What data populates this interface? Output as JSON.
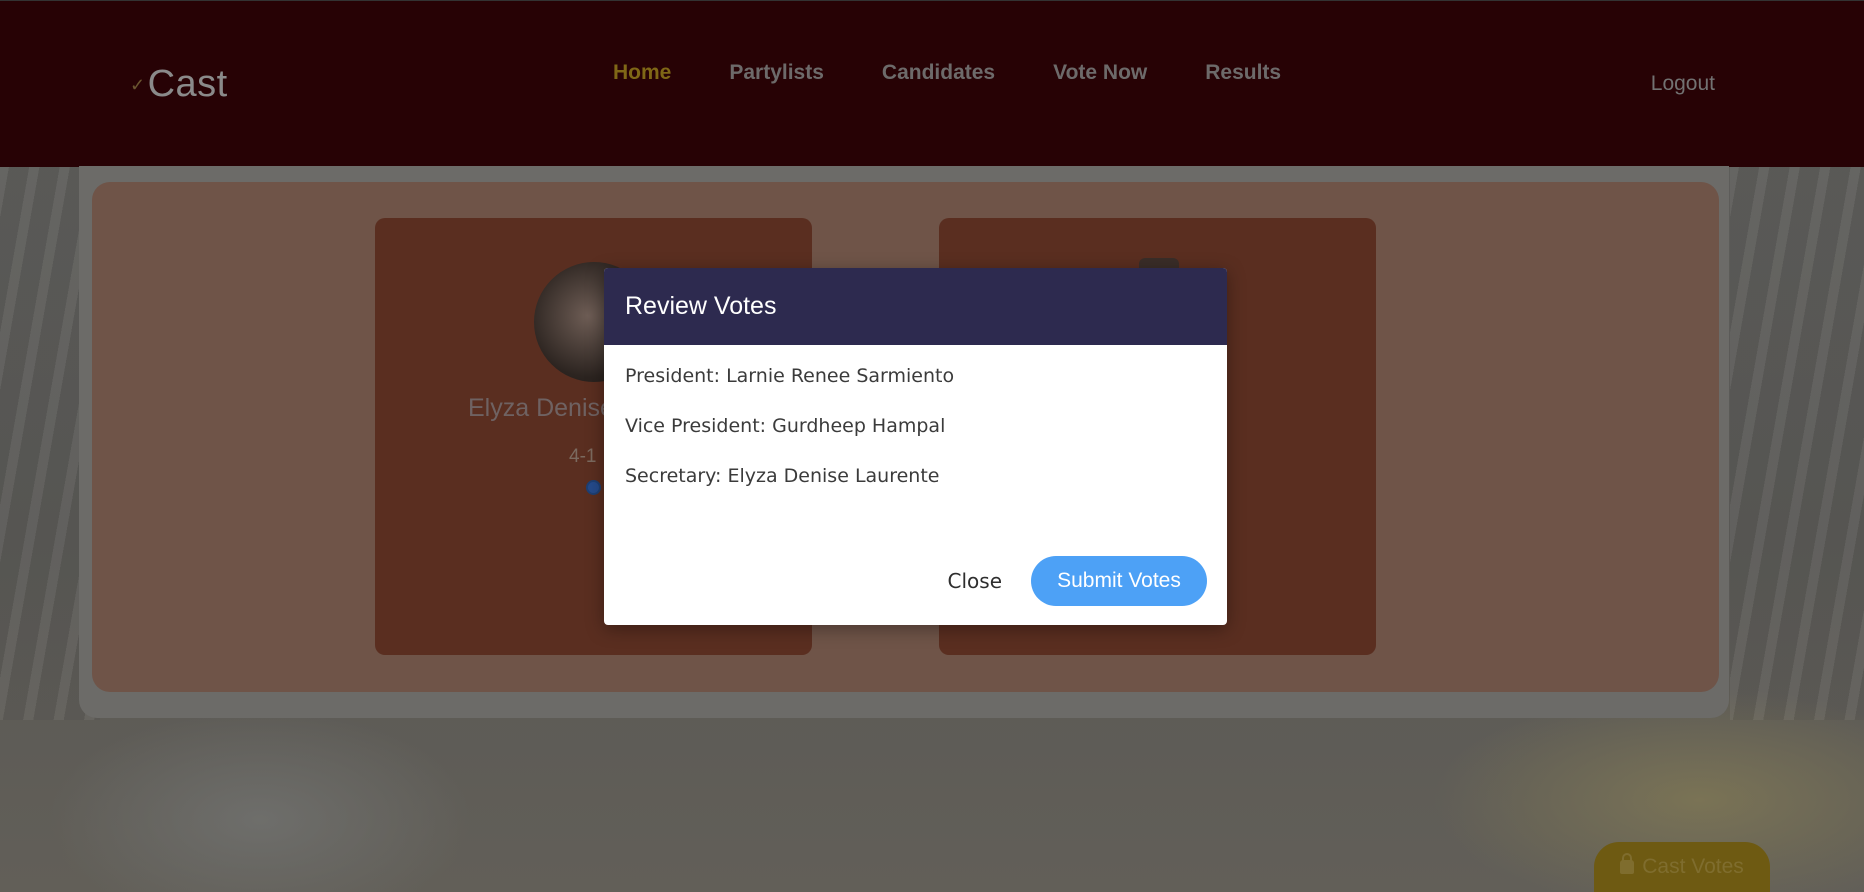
{
  "app": {
    "logo_text": "Cast"
  },
  "nav": {
    "items": [
      {
        "label": "Home",
        "active": true
      },
      {
        "label": "Partylists",
        "active": false
      },
      {
        "label": "Candidates",
        "active": false
      },
      {
        "label": "Vote Now",
        "active": false
      },
      {
        "label": "Results",
        "active": false
      }
    ],
    "logout_label": "Logout"
  },
  "candidates": {
    "left": {
      "name_partial": "Elyza Denise",
      "number_partial": "4-1"
    }
  },
  "cast_votes_button": {
    "label": "Cast Votes",
    "icon": "lock-icon"
  },
  "modal": {
    "title": "Review Votes",
    "votes": [
      "President: Larnie Renee Sarmiento",
      "Vice President: Gurdheep Hampal",
      "Secretary: Elyza Denise Laurente"
    ],
    "close_label": "Close",
    "submit_label": "Submit Votes"
  },
  "colors": {
    "header_bg": "#270205",
    "modal_header_bg": "#2d2a4f",
    "submit_button": "#4da1f6",
    "nav_active": "#7f6716"
  }
}
